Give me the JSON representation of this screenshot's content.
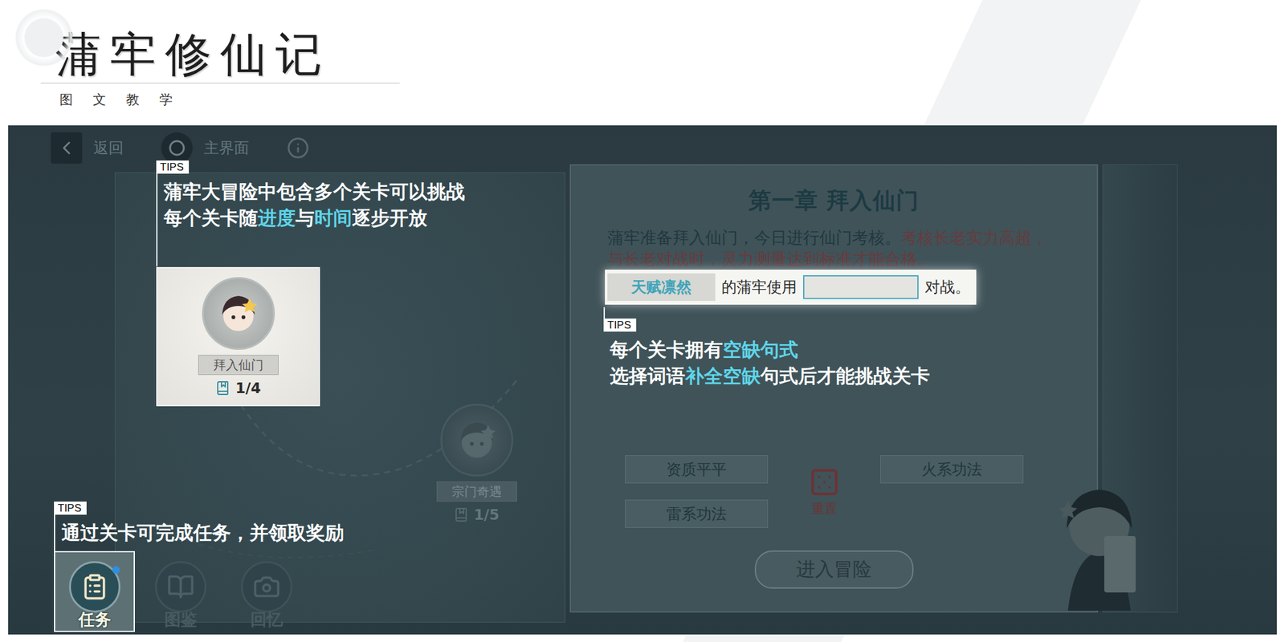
{
  "header": {
    "title": "蒲牢修仙记",
    "subtitle": "图文教学"
  },
  "top_bar": {
    "back": "返回",
    "home": "主界面"
  },
  "levels": [
    {
      "name": "拜入仙门",
      "progress": "1/4",
      "highlighted": true
    },
    {
      "name": "宗门奇遇",
      "progress": "1/5",
      "highlighted": false
    }
  ],
  "chapter": {
    "title": "第一章 拜入仙门",
    "description": [
      {
        "text": "蒲牢准备拜入仙门，今日进行仙门考核。",
        "emphasis": false
      },
      {
        "text": "考核长老实力高超，与长老对战时，灵力测量达到标准才能合格。",
        "emphasis": true
      }
    ]
  },
  "sentence": {
    "trait": "天赋凛然",
    "middle": "的蒲牢使用",
    "blank_filled": false,
    "end": "对战。",
    "highlighted": true
  },
  "options": [
    {
      "label": "资质平平"
    },
    {
      "label": "火系功法"
    },
    {
      "label": "雷系功法"
    }
  ],
  "reset": "重置",
  "start_button": "进入冒险",
  "nav": [
    {
      "label": "任务",
      "highlighted": true,
      "badge": true
    },
    {
      "label": "图鉴",
      "highlighted": false,
      "badge": false
    },
    {
      "label": "回忆",
      "highlighted": false,
      "badge": false
    }
  ],
  "tips": [
    {
      "label": "TIPS",
      "lines": [
        [
          {
            "text": "蒲牢大冒险中包含多个关卡可以挑战",
            "accent": false
          }
        ],
        [
          {
            "text": "每个关卡随",
            "accent": false
          },
          {
            "text": "进度",
            "accent": true
          },
          {
            "text": "与",
            "accent": false
          },
          {
            "text": "时间",
            "accent": true
          },
          {
            "text": "逐步开放",
            "accent": false
          }
        ]
      ]
    },
    {
      "label": "TIPS",
      "lines": [
        [
          {
            "text": "每个关卡拥有",
            "accent": false
          },
          {
            "text": "空缺句式",
            "accent": true
          }
        ],
        [
          {
            "text": "选择词语",
            "accent": false
          },
          {
            "text": "补全空缺",
            "accent": true
          },
          {
            "text": "句式后才能挑战关卡",
            "accent": false
          }
        ]
      ]
    },
    {
      "label": "TIPS",
      "lines": [
        [
          {
            "text": "通过关卡可完成任务，并领取奖励",
            "accent": false
          }
        ]
      ]
    }
  ]
}
